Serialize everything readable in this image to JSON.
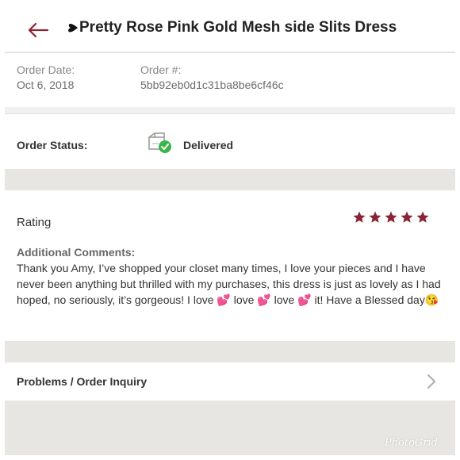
{
  "header": {
    "back_icon": "back-arrow-icon",
    "title": "Pretty Rose Pink Gold Mesh side Slits Dress",
    "title_prefix_icon": "heart-icon",
    "accent_color": "#8a2432"
  },
  "order": {
    "date_label": "Order Date:",
    "date_value": "Oct 6, 2018",
    "number_label": "Order #:",
    "number_value": "5bb92eb0d1c31ba8be6cf46c"
  },
  "status": {
    "label": "Order Status:",
    "icon": "package-delivered-icon",
    "value": "Delivered",
    "check_color": "#3bb54a"
  },
  "rating": {
    "label": "Rating",
    "stars": 5,
    "max_stars": 5,
    "star_color": "#8a2432",
    "comments_label": "Additional Comments:",
    "comments": "Thank you Amy, I’ve shopped your closet many times, I love your pieces and I have never been anything but thrilled with my purchases, this dress is just as lovely as I had hoped, no seriously, it’s gorgeous! I love 💕 love 💕 love 💕 it! Have a Blessed day😘"
  },
  "problems": {
    "label": "Problems / Order Inquiry",
    "icon": "chevron-right-icon"
  },
  "watermark": "PhotoGrid"
}
